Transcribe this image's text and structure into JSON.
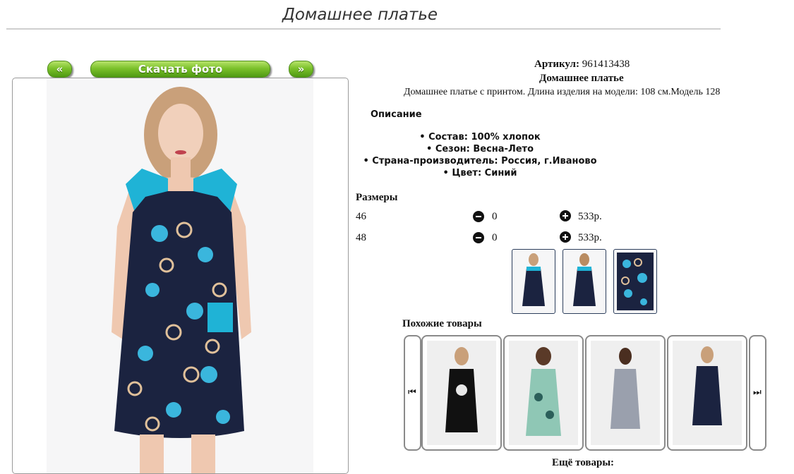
{
  "page": {
    "title": "Домашнее платье"
  },
  "photo_controls": {
    "prev_label": "«",
    "download_label": "Скачать фото",
    "next_label": "»"
  },
  "product": {
    "article_label": "Артикул:",
    "article_value": "961413438",
    "name": "Домашнее платье",
    "summary": "Домашнее платье с принтом. Длина изделия на модели: 108 см.Модель 128",
    "description_heading": "Описание",
    "description_items": [
      "Состав: 100% хлопок",
      "Сезон: Весна-Лето",
      "Страна-производитель: Россия, г.Иваново",
      "Цвет: Синий"
    ]
  },
  "sizes": {
    "heading": "Размеры",
    "rows": [
      {
        "size": "46",
        "qty": "0",
        "price": "533р."
      },
      {
        "size": "48",
        "qty": "0",
        "price": "533р."
      }
    ]
  },
  "similar": {
    "heading": "Похожие товары",
    "prev_icon": "skip-previous-icon",
    "next_icon": "skip-next-icon",
    "prev_glyph": "⏮",
    "next_glyph": "⏭"
  },
  "more": {
    "label": "Ещё товары:"
  },
  "colors": {
    "accent_green": "#7cc12c",
    "dress_navy": "#1b2340",
    "dress_turquoise": "#1fb3d6"
  }
}
